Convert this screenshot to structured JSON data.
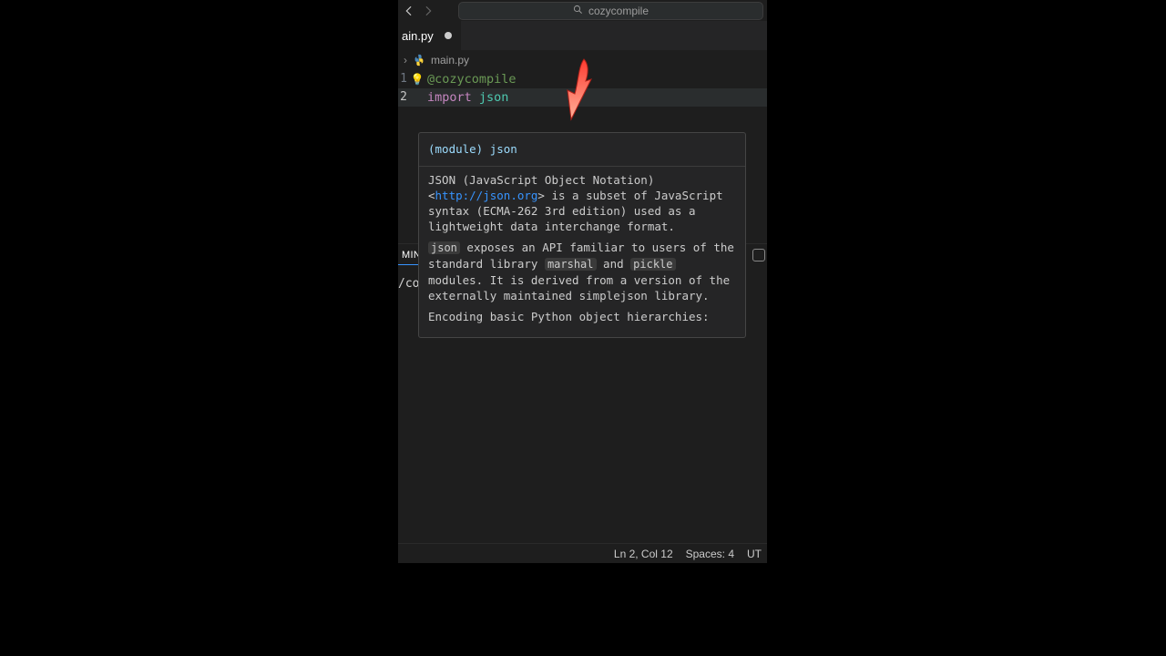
{
  "titlebar": {
    "search_text": "cozycompile"
  },
  "tab": {
    "filename_visible": "ain.py"
  },
  "breadcrumb": {
    "file": "main.py"
  },
  "editor": {
    "lines": [
      {
        "num": "1",
        "tokens": {
          "decorator": "@cozycompile"
        }
      },
      {
        "num": "2",
        "tokens": {
          "keyword": "import ",
          "module": "json"
        }
      }
    ]
  },
  "hover": {
    "signature": "(module) json",
    "p1_pre": "JSON (JavaScript Object Notation) <",
    "p1_link": "http://json.org",
    "p1_post": "> is a subset of JavaScript syntax (ECMA-262 3rd edition) used as a lightweight data interchange format.",
    "p2_code1": "json",
    "p2_mid1": " exposes an API familiar to users of the standard library ",
    "p2_code2": "marshal",
    "p2_mid2": " and ",
    "p2_code3": "pickle",
    "p2_mid3": " modules. It is derived from a version of the externally maintained simplejson library.",
    "p3": "Encoding basic Python object hierarchies:"
  },
  "panel": {
    "active_tab_visible": "MINA"
  },
  "terminal": {
    "prompt_visible": "/compile$ "
  },
  "statusbar": {
    "cursor": "Ln 2, Col 12",
    "spaces": "Spaces: 4",
    "encoding": "UT"
  }
}
